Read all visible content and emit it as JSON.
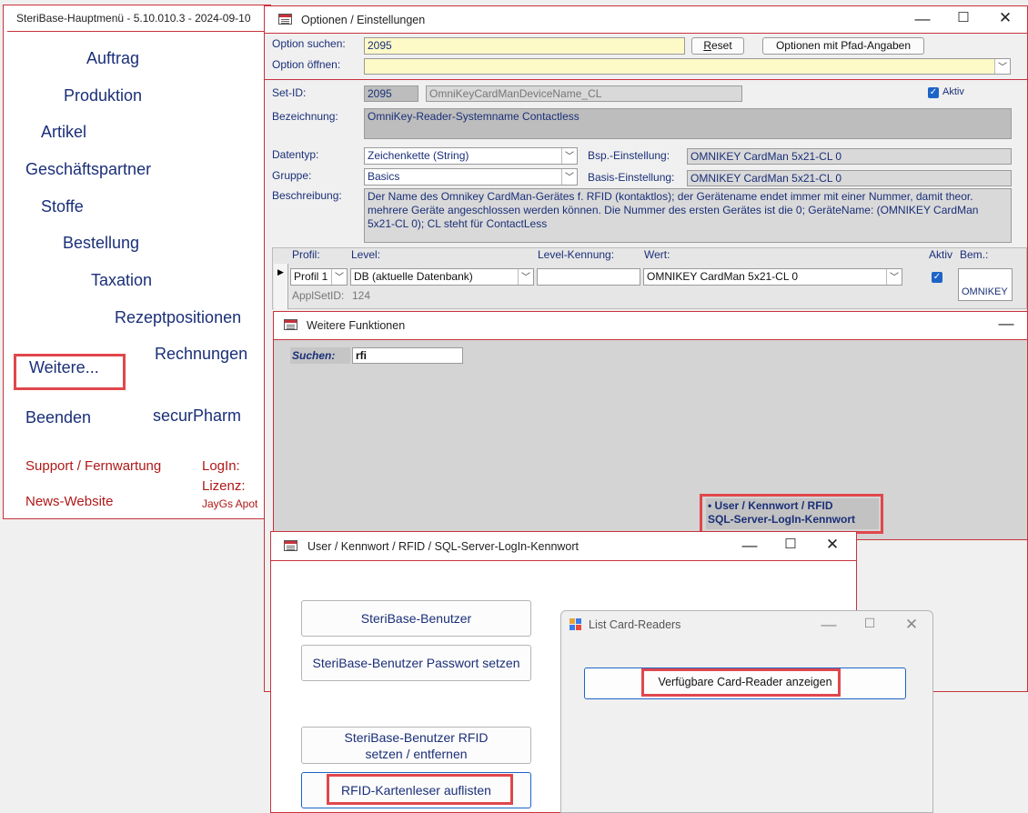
{
  "main_menu": {
    "title": "SteriBase-Hauptmenü  -  5.10.010.3 - 2024-09-10",
    "items": [
      "Auftrag",
      "Produktion",
      "Artikel",
      "Geschäftspartner",
      "Stoffe",
      "Bestellung",
      "Taxation",
      "Rezeptpositionen",
      "Rechnungen",
      "Weitere...",
      "Beenden",
      "securPharm"
    ],
    "support": "Support / Fernwartung",
    "news": "News-Website",
    "login_label": "LogIn:",
    "lizenz_label": "Lizenz:",
    "lizenz_value": "JayGs Apot"
  },
  "options_window": {
    "title": "Optionen / Einstellungen",
    "search_label": "Option suchen:",
    "search_value": "2095",
    "reset_button": "Reset",
    "pfad_button": "Optionen mit Pfad-Angaben",
    "open_label": "Option öffnen:",
    "open_value": "",
    "setid_label": "Set-ID:",
    "setid_value": "2095",
    "setid_name": "OmniKeyCardManDeviceName_CL",
    "aktiv_label": "Aktiv",
    "bezeichnung_label": "Bezeichnung:",
    "bezeichnung_value": "OmniKey-Reader-Systemname Contactless",
    "datentyp_label": "Datentyp:",
    "datentyp_value": "Zeichenkette (String)",
    "bsp_label": "Bsp.-Einstellung:",
    "bsp_value": "OMNIKEY CardMan 5x21-CL 0",
    "gruppe_label": "Gruppe:",
    "gruppe_value": "Basics",
    "basis_label": "Basis-Einstellung:",
    "basis_value": "OMNIKEY CardMan 5x21-CL 0",
    "beschreibung_label": "Beschreibung:",
    "beschreibung_value": "Der Name des Omnikey CardMan-Gerätes f. RFID (kontaktlos); der Gerätename endet immer mit einer Nummer, damit theor. mehrere Geräte angeschlossen werden können. Die Nummer des ersten Gerätes ist die 0; GeräteName: (OMNIKEY CardMan 5x21-CL 0); CL steht für ContactLess",
    "grid": {
      "headers": [
        "Profil:",
        "Level:",
        "Level-Kennung:",
        "Wert:",
        "Aktiv",
        "Bem.:"
      ],
      "profil": "Profil 1",
      "level": "DB  (aktuelle Datenbank)",
      "level_kennung": "",
      "wert": "OMNIKEY CardMan 5x21-CL 0",
      "bem": "OMNIKEY",
      "applsetid_label": "ApplSetID:",
      "applsetid_value": "124"
    }
  },
  "weitere_window": {
    "title": "Weitere Funktionen",
    "search_label": "Suchen:",
    "search_value": "rfi",
    "result_line1": "• User / Kennwort / RFID",
    "result_line2": "SQL-Server-LogIn-Kennwort"
  },
  "user_dialog": {
    "title": "User / Kennwort / RFID / SQL-Server-LogIn-Kennwort",
    "btn_benutzer": "SteriBase-Benutzer",
    "btn_passwort": "SteriBase-Benutzer Passwort setzen",
    "btn_rfid_line1": "SteriBase-Benutzer RFID",
    "btn_rfid_line2": "setzen / entfernen",
    "btn_kartenleser": "RFID-Kartenleser auflisten"
  },
  "card_readers_dialog": {
    "title": "List Card-Readers",
    "show_button": "Verfügbare Card-Reader anzeigen"
  },
  "colors": {
    "accent_red": "#c8323c",
    "highlight_red": "#e0474c",
    "link_blue": "#1a2f78",
    "support_red": "#b01818"
  }
}
